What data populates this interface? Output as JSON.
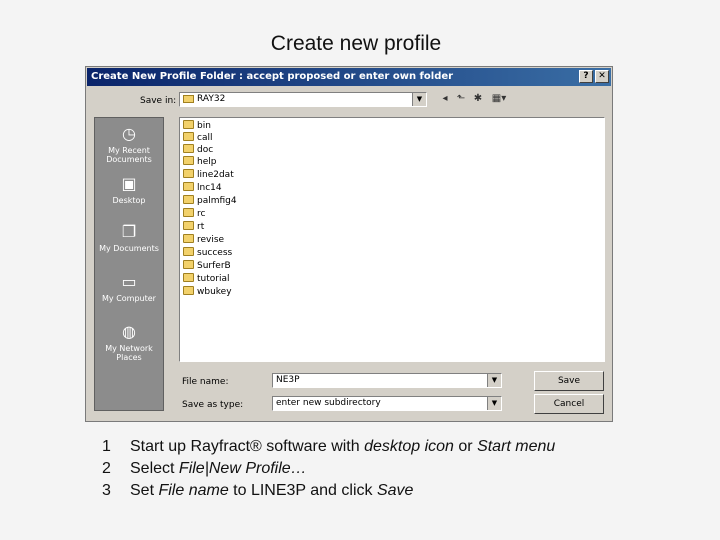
{
  "slide": {
    "title": "Create new profile"
  },
  "dialog": {
    "title": "Create New Profile Folder : accept proposed or enter own folder",
    "help_glyph": "?",
    "close_glyph": "✕",
    "save_in_label": "Save in:",
    "save_in_value": "RAY32",
    "places": [
      {
        "label": "My Recent Documents",
        "icon": "recent-documents-icon"
      },
      {
        "label": "Desktop",
        "icon": "desktop-icon"
      },
      {
        "label": "My Documents",
        "icon": "my-documents-icon"
      },
      {
        "label": "My Computer",
        "icon": "my-computer-icon"
      },
      {
        "label": "My Network Places",
        "icon": "network-places-icon"
      }
    ],
    "folders": [
      "bin",
      "call",
      "doc",
      "help",
      "line2dat",
      "lnc14",
      "palmfig4",
      "rc",
      "rt",
      "revise",
      "success",
      "SurferB",
      "tutorial",
      "wbukey"
    ],
    "file_name_label": "File name:",
    "file_name_value": "NE3P",
    "save_type_label": "Save as type:",
    "save_type_value": "enter new subdirectory",
    "save_button": "Save",
    "cancel_button": "Cancel"
  },
  "steps": [
    {
      "num": "1",
      "text1": "Start up Rayfract® software with ",
      "em1": "desktop icon",
      "text2": " or ",
      "em2": "Start menu"
    },
    {
      "num": "2",
      "text1": "Select ",
      "em1": "File|New Profile…",
      "text2": "",
      "em2": ""
    },
    {
      "num": "3",
      "text1": "Set ",
      "em1": "File name",
      "text2": " to LINE3P and click ",
      "em2": "Save"
    }
  ]
}
